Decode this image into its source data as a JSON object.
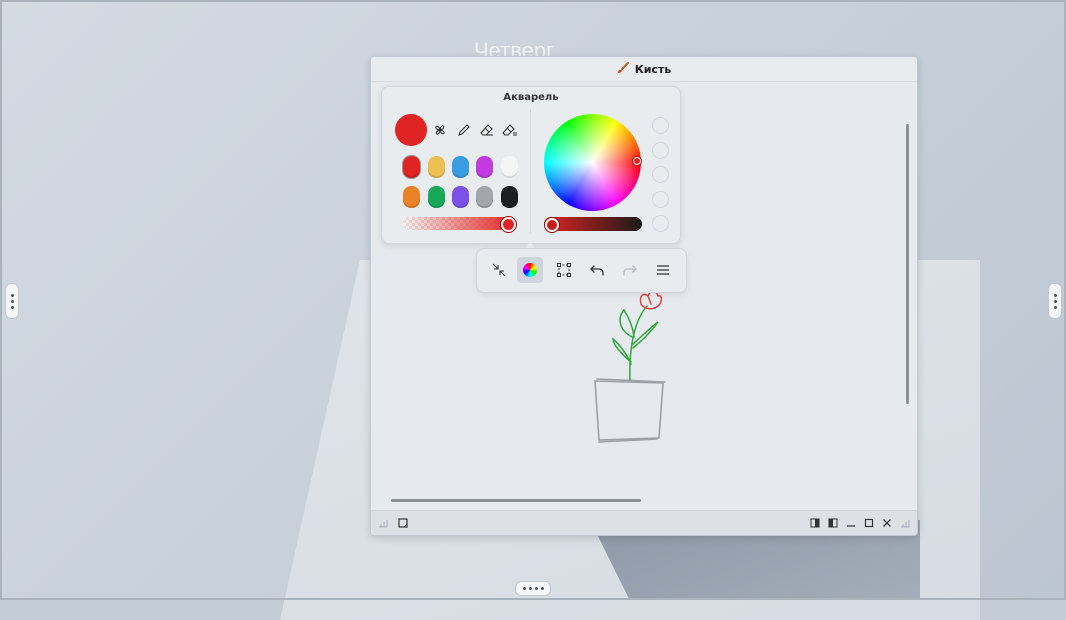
{
  "desktop": {
    "background_text": "Четверг"
  },
  "window": {
    "title": "Кисть",
    "title_icon": "brush-icon"
  },
  "brush_panel": {
    "title": "Акварель",
    "current_color": "#e02323",
    "tools": [
      "brush-type-icon",
      "pen-icon",
      "eraser-icon",
      "eraser-clear-icon"
    ],
    "swatches_row1": [
      "#e02323",
      "#ecc050",
      "#3a9de3",
      "#c13be0",
      "#f4f5f6"
    ],
    "swatches_row2": [
      "#ea8228",
      "#18a857",
      "#7c52e6",
      "#a3a6ab",
      "#1c1f22"
    ],
    "opacity_percent": 100
  },
  "toolbar": {
    "buttons": [
      "collapse-icon",
      "color-icon",
      "selection-icon",
      "undo-icon",
      "redo-icon",
      "menu-icon"
    ]
  },
  "colors": {
    "accent": "#e02323",
    "stem": "#2fa83a",
    "pot": "#9da1a6"
  }
}
